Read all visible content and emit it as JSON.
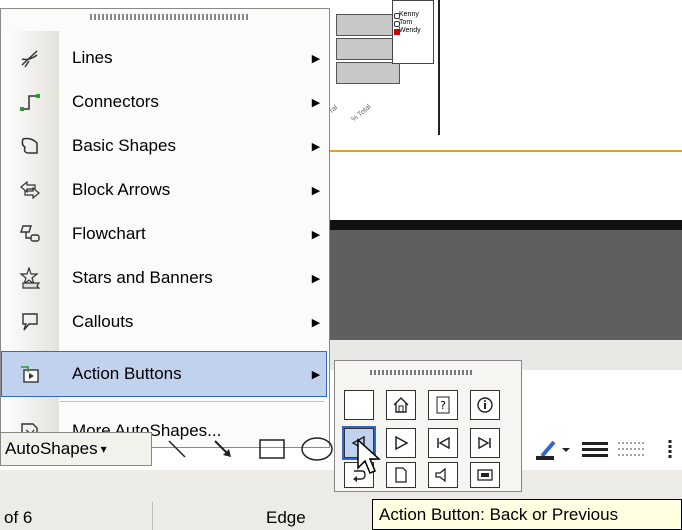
{
  "menu": {
    "items": [
      {
        "label": "Lines",
        "icon": "lines-icon",
        "submenu": true
      },
      {
        "label": "Connectors",
        "icon": "connectors-icon",
        "submenu": true
      },
      {
        "label": "Basic Shapes",
        "icon": "basic-shapes-icon",
        "submenu": true
      },
      {
        "label": "Block Arrows",
        "icon": "block-arrows-icon",
        "submenu": true
      },
      {
        "label": "Flowchart",
        "icon": "flowchart-icon",
        "submenu": true
      },
      {
        "label": "Stars and Banners",
        "icon": "stars-banners-icon",
        "submenu": true
      },
      {
        "label": "Callouts",
        "icon": "callouts-icon",
        "submenu": true
      },
      {
        "label": "Action Buttons",
        "icon": "action-buttons-icon",
        "submenu": true,
        "active": true
      },
      {
        "label": "More AutoShapes...",
        "icon": "more-autoshapes-icon",
        "submenu": false
      }
    ],
    "arrow_glyph": "▶"
  },
  "toolbar": {
    "autoshapes_label": "AutoShapes",
    "dropdown_glyph": "▾"
  },
  "status": {
    "slide_text": "of 6",
    "design_text": "Edge"
  },
  "tooltip": {
    "text": "Action Button: Back or Previous"
  },
  "legend": [
    "Kenny",
    "Tom",
    "Wendy"
  ],
  "chart_labels": [
    "ral",
    "% Total"
  ],
  "colors": {
    "menu_highlight": "#c1d2ee",
    "highlight_border": "#316ac5",
    "tooltip_bg": "#ffffe1",
    "accent_line": "#e0a020"
  }
}
